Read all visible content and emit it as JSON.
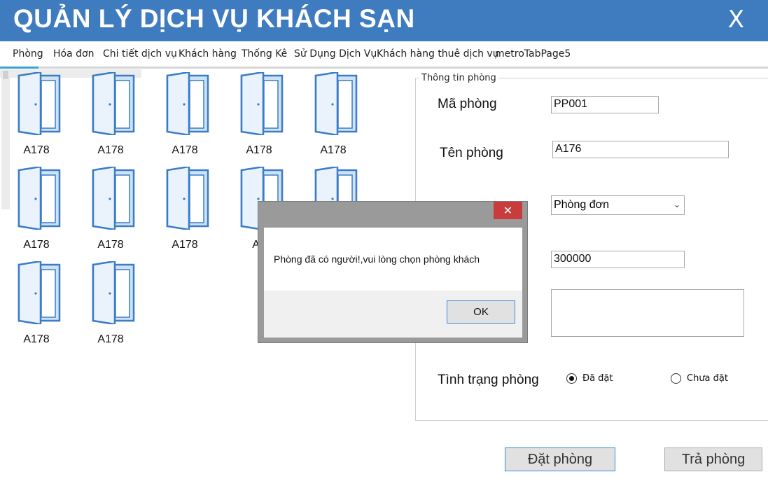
{
  "app": {
    "title": "QUẢN LÝ DỊCH VỤ KHÁCH SẠN",
    "close_label": "X"
  },
  "tabs": [
    {
      "label": "Phòng"
    },
    {
      "label": "Hóa đơn"
    },
    {
      "label": "Chi tiết dịch vụ"
    },
    {
      "label": "Khách hàng"
    },
    {
      "label": "Thống Kê"
    },
    {
      "label": "Sử Dụng Dịch Vụ"
    },
    {
      "label": "Khách hàng thuê dịch vụ"
    },
    {
      "label": "metroTabPage5"
    }
  ],
  "rooms": [
    {
      "label": "A178",
      "icon": "door-icon"
    },
    {
      "label": "A178",
      "icon": "door-icon"
    },
    {
      "label": "A178",
      "icon": "door-icon"
    },
    {
      "label": "A178",
      "icon": "door-icon"
    },
    {
      "label": "A178",
      "icon": "door-icon"
    },
    {
      "label": "A178",
      "icon": "door-icon"
    },
    {
      "label": "A178",
      "icon": "door-icon"
    },
    {
      "label": "A178",
      "icon": "door-icon"
    },
    {
      "label": "A1",
      "icon": "door-icon"
    },
    {
      "label": "",
      "icon": "door-icon"
    },
    {
      "label": "A178",
      "icon": "door-icon"
    },
    {
      "label": "A178",
      "icon": "door-icon"
    }
  ],
  "room_info": {
    "group_title": "Thông tin phòng",
    "ma_phong_label": "Mã phòng",
    "ma_phong_value": "PP001",
    "ten_phong_label": "Tên phòng",
    "ten_phong_value": "A176",
    "loai_phong_value": "Phòng đơn",
    "gia_value": "300000",
    "ghi_chu_value": "",
    "tinh_trang_label": "Tình trạng phòng",
    "radio_da_dat": "Đã đặt",
    "radio_chua_dat": "Chưa đặt",
    "status_selected": "Đã đặt"
  },
  "actions": {
    "dat_phong": "Đặt phòng",
    "tra_phong": "Trả phòng"
  },
  "dialog": {
    "message": "Phòng đã có người!,vui lòng chọn phòng khách",
    "ok_label": "OK",
    "close_label": "✕"
  },
  "colors": {
    "title_bar": "#3f7cbf",
    "tab_active_indicator": "#36a1d6",
    "dialog_close": "#c83c3c",
    "door_outline": "#3a7cc8",
    "door_fill": "#cfe3f7"
  }
}
